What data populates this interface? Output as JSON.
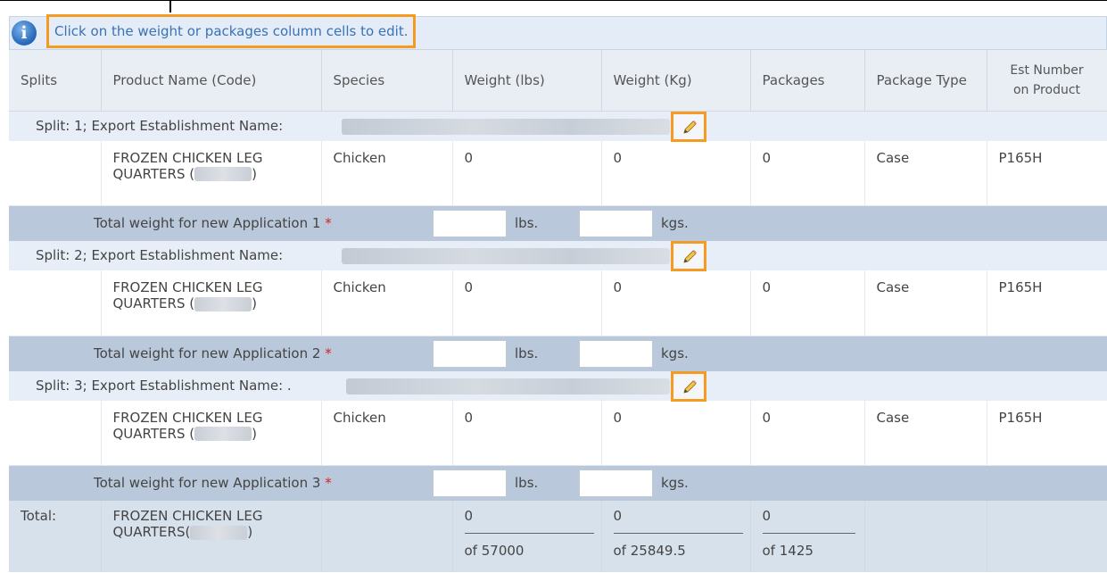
{
  "info": {
    "icon": "info-icon",
    "icon_glyph": "i",
    "message": "Click on the weight or packages column cells to edit."
  },
  "columns": {
    "splits": "Splits",
    "product": "Product Name (Code)",
    "species": "Species",
    "weight_lbs": "Weight (lbs)",
    "weight_kg": "Weight (Kg)",
    "packages": "Packages",
    "package_type": "Package Type",
    "est_number_1": "Est Number",
    "est_number_2": "on Product"
  },
  "splits": [
    {
      "label": "Split: 1; Export Establishment Name:",
      "product_line1": "FROZEN CHICKEN LEG",
      "product_line2_pre": "QUARTERS (",
      "product_line2_post": ")",
      "species": "Chicken",
      "weight_lbs": "0",
      "weight_kg": "0",
      "packages": "0",
      "package_type": "Case",
      "est_number": "P165H",
      "total_label": "Total weight for new Application 1",
      "required_mark": "*",
      "lbs_unit": "lbs.",
      "kgs_unit": "kgs."
    },
    {
      "label": "Split: 2; Export Establishment Name:",
      "product_line1": "FROZEN CHICKEN LEG",
      "product_line2_pre": "QUARTERS (",
      "product_line2_post": ")",
      "species": "Chicken",
      "weight_lbs": "0",
      "weight_kg": "0",
      "packages": "0",
      "package_type": "Case",
      "est_number": "P165H",
      "total_label": "Total weight for new Application 2",
      "required_mark": "*",
      "lbs_unit": "lbs.",
      "kgs_unit": "kgs."
    },
    {
      "label": "Split: 3; Export Establishment Name: .",
      "product_line1": "FROZEN CHICKEN LEG",
      "product_line2_pre": "QUARTERS (",
      "product_line2_post": ")",
      "species": "Chicken",
      "weight_lbs": "0",
      "weight_kg": "0",
      "packages": "0",
      "package_type": "Case",
      "est_number": "P165H",
      "total_label": "Total weight for new Application 3",
      "required_mark": "*",
      "lbs_unit": "lbs.",
      "kgs_unit": "kgs."
    }
  ],
  "grand_total": {
    "label": "Total:",
    "product_line1": "FROZEN CHICKEN LEG",
    "product_line2_pre": "QUARTERS(",
    "product_line2_post": ")",
    "weight_lbs": "0",
    "weight_lbs_of": "of 57000",
    "weight_kg": "0",
    "weight_kg_of": "of 25849.5",
    "packages": "0",
    "packages_of": "of 1425"
  },
  "colors": {
    "highlight": "#f59a23",
    "info_text": "#3a72b5",
    "split_row_bg": "#e7eef8",
    "total_row_bg": "#b9c8da",
    "required": "#d9211c"
  }
}
